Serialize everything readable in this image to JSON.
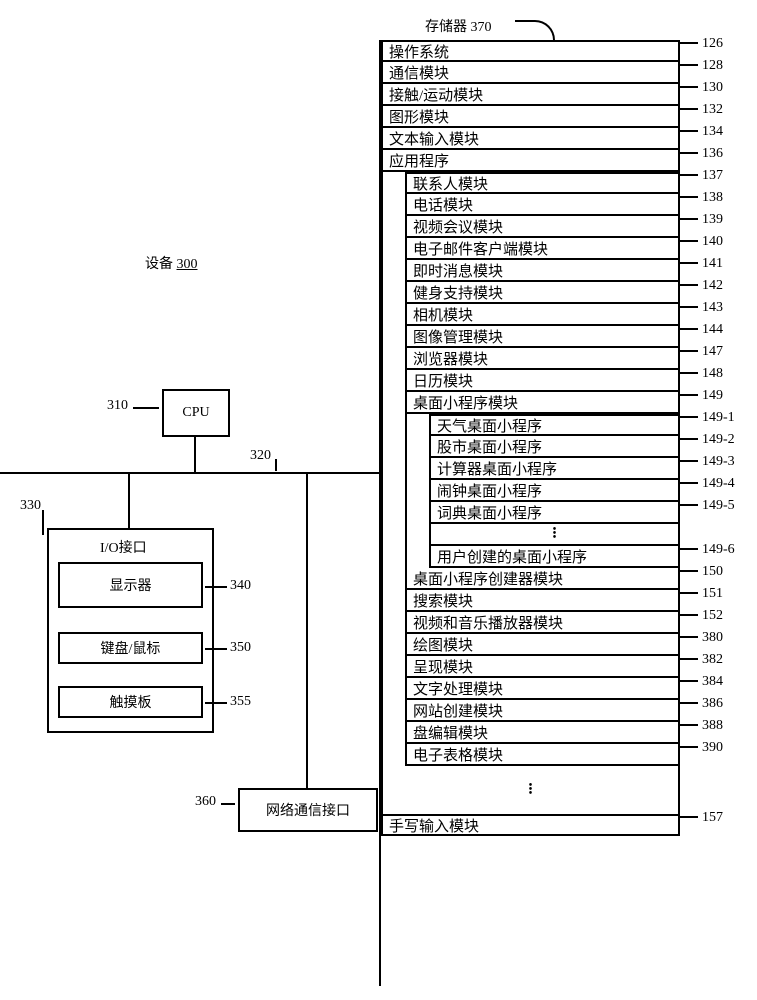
{
  "device_label": "设备",
  "device_ref_underline": "300",
  "cpu": {
    "label": "CPU",
    "ref": "310"
  },
  "bus_ref": "320",
  "io": {
    "label": "I/O接口",
    "ref": "330",
    "display": {
      "label": "显示器",
      "ref": "340"
    },
    "keyboard": {
      "label": "键盘/鼠标",
      "ref": "350"
    },
    "touchpad": {
      "label": "触摸板",
      "ref": "355"
    }
  },
  "net": {
    "label": "网络通信接口",
    "ref": "360"
  },
  "memory_header": {
    "label": "存储器",
    "ref": "370"
  },
  "memory": [
    {
      "text": "操作系统",
      "ref": "126",
      "indent": 0
    },
    {
      "text": "通信模块",
      "ref": "128",
      "indent": 0
    },
    {
      "text": "接触/运动模块",
      "ref": "130",
      "indent": 0
    },
    {
      "text": "图形模块",
      "ref": "132",
      "indent": 0
    },
    {
      "text": "文本输入模块",
      "ref": "134",
      "indent": 0
    },
    {
      "text": "应用程序",
      "ref": "136",
      "indent": 0
    },
    {
      "text": "联系人模块",
      "ref": "137",
      "indent": 1
    },
    {
      "text": "电话模块",
      "ref": "138",
      "indent": 1
    },
    {
      "text": "视频会议模块",
      "ref": "139",
      "indent": 1
    },
    {
      "text": "电子邮件客户端模块",
      "ref": "140",
      "indent": 1
    },
    {
      "text": "即时消息模块",
      "ref": "141",
      "indent": 1
    },
    {
      "text": "健身支持模块",
      "ref": "142",
      "indent": 1
    },
    {
      "text": "相机模块",
      "ref": "143",
      "indent": 1
    },
    {
      "text": "图像管理模块",
      "ref": "144",
      "indent": 1
    },
    {
      "text": "浏览器模块",
      "ref": "147",
      "indent": 1
    },
    {
      "text": "日历模块",
      "ref": "148",
      "indent": 1
    },
    {
      "text": "桌面小程序模块",
      "ref": "149",
      "indent": 1
    },
    {
      "text": "天气桌面小程序",
      "ref": "149-1",
      "indent": 2
    },
    {
      "text": "股市桌面小程序",
      "ref": "149-2",
      "indent": 2
    },
    {
      "text": "计算器桌面小程序",
      "ref": "149-3",
      "indent": 2
    },
    {
      "text": "闹钟桌面小程序",
      "ref": "149-4",
      "indent": 2
    },
    {
      "text": "词典桌面小程序",
      "ref": "149-5",
      "indent": 2
    },
    {
      "text": "",
      "ref": "",
      "indent": 2,
      "dots": true
    },
    {
      "text": "用户创建的桌面小程序",
      "ref": "149-6",
      "indent": 2
    },
    {
      "text": "桌面小程序创建器模块",
      "ref": "150",
      "indent": 1
    },
    {
      "text": "搜索模块",
      "ref": "151",
      "indent": 1
    },
    {
      "text": "视频和音乐播放器模块",
      "ref": "152",
      "indent": 1
    },
    {
      "text": "绘图模块",
      "ref": "380",
      "indent": 1
    },
    {
      "text": "呈现模块",
      "ref": "382",
      "indent": 1
    },
    {
      "text": "文字处理模块",
      "ref": "384",
      "indent": 1
    },
    {
      "text": "网站创建模块",
      "ref": "386",
      "indent": 1
    },
    {
      "text": "盘编辑模块",
      "ref": "388",
      "indent": 1
    },
    {
      "text": "电子表格模块",
      "ref": "390",
      "indent": 1
    }
  ],
  "memory_gap_dots": true,
  "handwriting": {
    "text": "手写输入模块",
    "ref": "157"
  }
}
